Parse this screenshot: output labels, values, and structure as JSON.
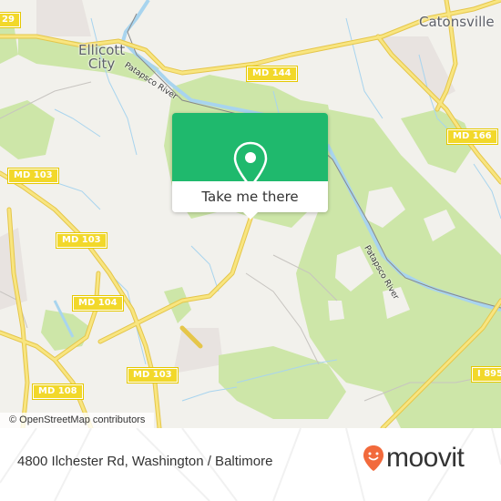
{
  "map": {
    "places": {
      "ellicott_city": "Ellicott\nCity",
      "catonsville": "Catonsville"
    },
    "road_shields": {
      "md144": "MD 144",
      "md166": "MD 166",
      "md103_a": "MD 103",
      "md103_b": "MD 103",
      "md103_c": "MD 103",
      "md104": "MD 104",
      "md108": "MD 108",
      "i895": "I 895",
      "us29": "29"
    },
    "river_labels": {
      "patapsco_north": "Patapsco River",
      "patapsco_east": "Patapsco River"
    },
    "attribution": "© OpenStreetMap contributors",
    "colors": {
      "land": "#f2f1ec",
      "park": "#cde6a8",
      "water": "#a8d4ee",
      "road": "#f5dc6b",
      "shield": "#f2d82a",
      "popup_green": "#1fb96d"
    }
  },
  "popup": {
    "icon": "map-pin-icon",
    "button_label": "Take me there"
  },
  "footer": {
    "address": "4800 Ilchester Rd, Washington / Baltimore",
    "brand": "moovit",
    "brand_icon": "moovit-smiley-pin-icon",
    "brand_color": "#f26a3c"
  }
}
